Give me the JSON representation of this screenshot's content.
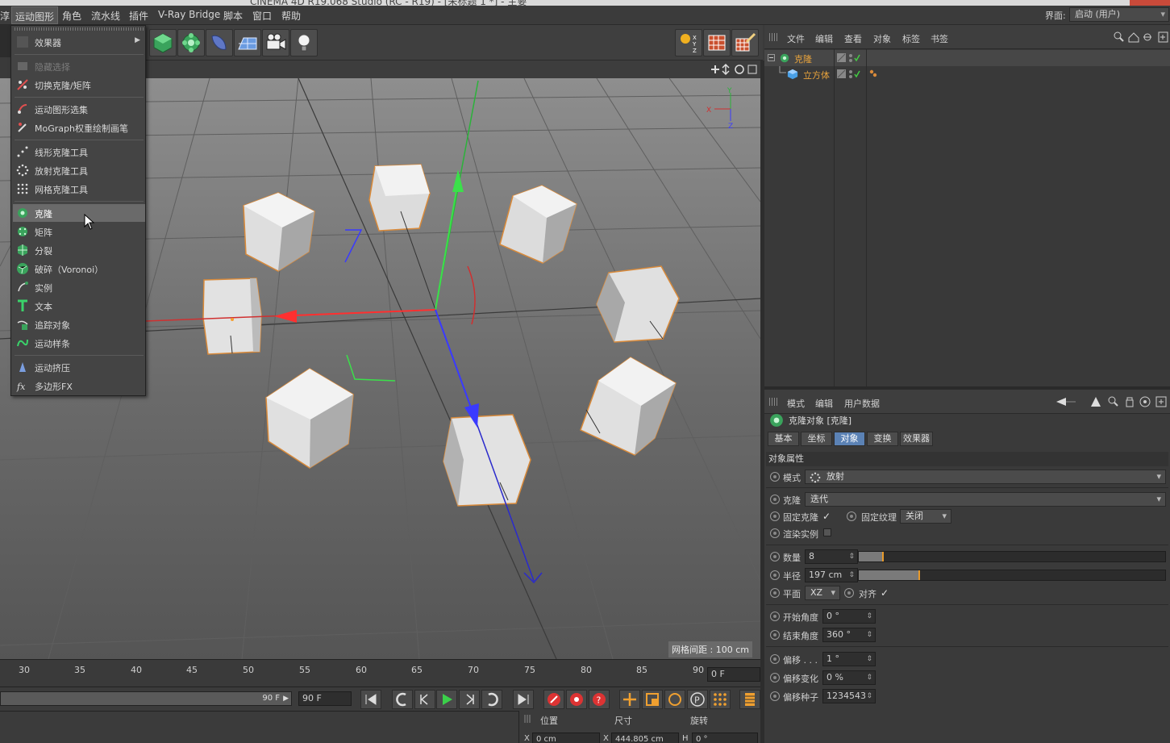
{
  "app": {
    "title": "CINEMA 4D R19.068 Studio (RC - R19) - [未标题 1 *] - 主要"
  },
  "menubar": {
    "items": [
      "淳",
      "运动图形",
      "角色",
      "流水线",
      "插件",
      "V-Ray Bridge",
      "脚本",
      "窗口",
      "帮助"
    ],
    "interface_label": "界面:",
    "interface_value": "启动 (用户)"
  },
  "dropdown": {
    "items": [
      {
        "label": "效果器",
        "icon": "effector-icon",
        "submenu": true
      },
      {
        "label": "隐藏选择",
        "icon": "hide-selection-icon",
        "disabled": true
      },
      {
        "label": "切换克隆/矩阵",
        "icon": "toggle-cloner-icon"
      },
      {
        "label": "运动图形选集",
        "icon": "mograph-selection-icon"
      },
      {
        "label": "MoGraph权重绘制画笔",
        "icon": "weight-brush-icon"
      },
      {
        "label": "线形克隆工具",
        "icon": "linear-cloner-icon"
      },
      {
        "label": "放射克隆工具",
        "icon": "radial-cloner-icon"
      },
      {
        "label": "网格克隆工具",
        "icon": "grid-cloner-icon"
      },
      {
        "label": "克隆",
        "icon": "cloner-icon",
        "hover": true
      },
      {
        "label": "矩阵",
        "icon": "matrix-icon"
      },
      {
        "label": "分裂",
        "icon": "fracture-icon"
      },
      {
        "label": "破碎（Voronoi）",
        "icon": "voronoi-icon"
      },
      {
        "label": "实例",
        "icon": "instance-icon"
      },
      {
        "label": "文本",
        "icon": "text-icon"
      },
      {
        "label": "追踪对象",
        "icon": "tracer-icon"
      },
      {
        "label": "运动样条",
        "icon": "mospline-icon"
      },
      {
        "label": "运动挤压",
        "icon": "extrude-icon"
      },
      {
        "label": "多边形FX",
        "icon": "polyfx-icon"
      }
    ]
  },
  "viewport": {
    "grid_info": "网格间距 : 100 cm",
    "axis_labels": {
      "x": "X",
      "y": "Y",
      "z": "Z"
    }
  },
  "timeline": {
    "ticks": [
      "30",
      "35",
      "40",
      "45",
      "50",
      "55",
      "60",
      "65",
      "70",
      "75",
      "80",
      "85",
      "90"
    ],
    "current_frame": "0 F",
    "slider_end": "90 F",
    "end_frame": "90 F"
  },
  "coords": {
    "position_label": "位置",
    "size_label": "尺寸",
    "rotation_label": "旋转",
    "x_label": "X",
    "x_pos": "0 cm",
    "x_size": "444.805 cm",
    "h_label": "H",
    "h_rot": "0 °"
  },
  "object_manager": {
    "menu": [
      "文件",
      "编辑",
      "查看",
      "对象",
      "标签",
      "书签"
    ],
    "objects": [
      {
        "name": "克隆",
        "icon": "cloner-icon"
      },
      {
        "name": "立方体",
        "icon": "cube-icon"
      }
    ]
  },
  "attribute_manager": {
    "menu": [
      "模式",
      "编辑",
      "用户数据"
    ],
    "title": "克隆对象 [克隆]",
    "tabs": [
      "基本",
      "坐标",
      "对象",
      "变换",
      "效果器"
    ],
    "active_tab": "对象",
    "section": "对象属性",
    "mode_label": "模式",
    "mode_value": "放射",
    "clones_label": "克隆",
    "clones_value": "迭代",
    "fix_clone_label": "固定克隆",
    "fix_clone_check": "✓",
    "fix_texture_label": "固定纹理",
    "fix_texture_value": "关闭",
    "render_instances_label": "渲染实例",
    "count_label": "数量",
    "count_value": "8",
    "count_level": 0.08,
    "radius_label": "半径",
    "radius_value": "197 cm",
    "radius_level": 0.197,
    "plane_label": "平面",
    "plane_value": "XZ",
    "align_label": "对齐",
    "align_check": "✓",
    "start_angle_label": "开始角度",
    "start_angle_value": "0 °",
    "end_angle_label": "结束角度",
    "end_angle_value": "360 °",
    "offset_label": "偏移 . . .",
    "offset_value": "1 °",
    "offset_var_label": "偏移变化",
    "offset_var_value": "0 %",
    "offset_seed_label": "偏移种子",
    "offset_seed_value": "1234543"
  }
}
